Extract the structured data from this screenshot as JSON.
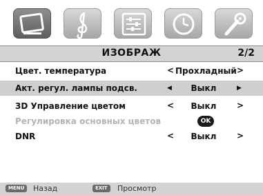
{
  "tabs": [
    {
      "name": "picture",
      "icon": "tv-screen-icon",
      "active": true
    },
    {
      "name": "sound",
      "icon": "treble-clef-icon",
      "active": false
    },
    {
      "name": "setup",
      "icon": "sliders-icon",
      "active": false
    },
    {
      "name": "time",
      "icon": "clock-icon",
      "active": false
    },
    {
      "name": "tools",
      "icon": "wrench-icon",
      "active": false
    }
  ],
  "header": {
    "title": "ИЗОБРАЖ",
    "page": "2/2"
  },
  "rows": [
    {
      "label": "Цвет. температура",
      "left": "<",
      "value": "Прохладный",
      "right": ">"
    },
    {
      "label": "Акт. регул. лампы подсв.",
      "left": "◀",
      "value": "Выкл",
      "right": "▶"
    },
    {
      "label": "3D Управление цветом",
      "left": "<",
      "value": "Выкл",
      "right": ">"
    },
    {
      "label": "Регулировка основных цветов",
      "badge": "OK"
    },
    {
      "label": "DNR",
      "left": "<",
      "value": "Выкл",
      "right": ">"
    }
  ],
  "footer": {
    "menu_key": "MENU",
    "menu_label": "Назад",
    "exit_key": "EXIT",
    "exit_label": "Просмотр"
  }
}
